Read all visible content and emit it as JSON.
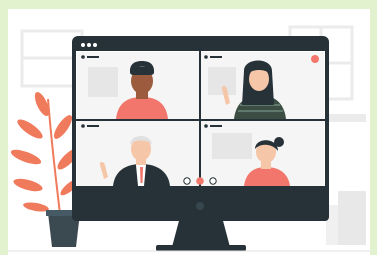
{
  "illustration": {
    "scene": "video-conference",
    "colors": {
      "frame_green": "#e2f2cf",
      "monitor_dark": "#263238",
      "accent_salmon": "#f2766b",
      "plant_leaf": "#f07a5c",
      "pot": "#3b4a51",
      "bg_shapes": "#ebebeb",
      "skin_light": "#f5c6a8",
      "skin_dark": "#9b5b3c",
      "hair_dark": "#263238",
      "shirt_green_stripes": "#3c4d44",
      "hair_grey": "#e0e0e0"
    },
    "controls": {
      "window_dots": 3,
      "call_buttons": [
        "mic-icon",
        "hangup-icon",
        "camera-icon"
      ]
    }
  }
}
